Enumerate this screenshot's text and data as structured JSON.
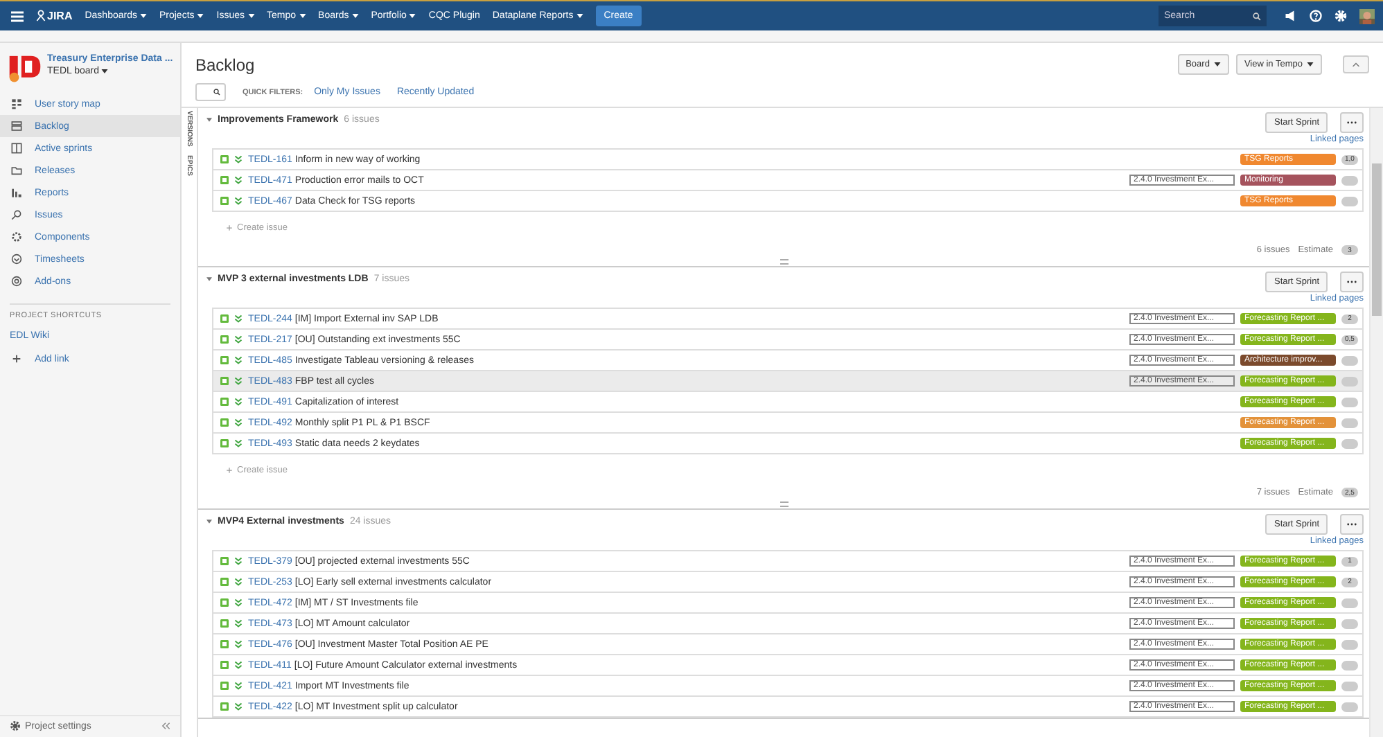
{
  "topnav": {
    "logo": "JIRA",
    "menus": [
      {
        "label": "Dashboards",
        "dropdown": true
      },
      {
        "label": "Projects",
        "dropdown": true
      },
      {
        "label": "Issues",
        "dropdown": true
      },
      {
        "label": "Tempo",
        "dropdown": true
      },
      {
        "label": "Boards",
        "dropdown": true
      },
      {
        "label": "Portfolio",
        "dropdown": true
      },
      {
        "label": "CQC Plugin",
        "dropdown": false
      },
      {
        "label": "Dataplane Reports",
        "dropdown": true
      }
    ],
    "create": "Create",
    "search": {
      "placeholder": "Search"
    }
  },
  "sidebar": {
    "project": "Treasury Enterprise Data ...",
    "board": "TEDL board",
    "items": [
      {
        "label": "User story map",
        "selected": false
      },
      {
        "label": "Backlog",
        "selected": true
      },
      {
        "label": "Active sprints",
        "selected": false
      },
      {
        "label": "Releases",
        "selected": false
      },
      {
        "label": "Reports",
        "selected": false
      },
      {
        "label": "Issues",
        "selected": false
      },
      {
        "label": "Components",
        "selected": false
      },
      {
        "label": "Timesheets",
        "selected": false
      },
      {
        "label": "Add-ons",
        "selected": false
      }
    ],
    "shortcuts_title": "PROJECT SHORTCUTS",
    "shortcuts": [
      "EDL Wiki"
    ],
    "add_link": "Add link",
    "settings": "Project settings"
  },
  "page": {
    "title": "Backlog",
    "quick_filters_label": "QUICK FILTERS:",
    "quick_filters": [
      "Only My Issues",
      "Recently Updated"
    ],
    "buttons": [
      "Board",
      "View in Tempo"
    ],
    "side_tabs": [
      "VERSIONS",
      "EPICS"
    ]
  },
  "sprints": [
    {
      "name": "Improvements Framework",
      "count": "6 issues",
      "start": "Start Sprint",
      "linked": "Linked pages",
      "create": "Create issue",
      "footer_count": "6 issues",
      "estimate_label": "Estimate",
      "estimate": "3",
      "issues": [
        {
          "key": "TEDL-161",
          "summary": "Inform in new way of working",
          "epic": "TSG Reports",
          "color": "#f0882f",
          "estimate": "1,0",
          "highlighted": false
        },
        {
          "key": "TEDL-471",
          "summary": "Production error mails to OCT",
          "version": "2.4.0 Investment Ex...",
          "epic": "Monitoring",
          "color": "#a5535d",
          "highlighted": false
        },
        {
          "key": "TEDL-467",
          "summary": "Data Check for TSG reports",
          "epic": "TSG Reports",
          "color": "#f0882f",
          "highlighted": false
        }
      ]
    },
    {
      "name": "MVP 3 external investments LDB",
      "count": "7 issues",
      "start": "Start Sprint",
      "linked": "Linked pages",
      "create": "Create issue",
      "footer_count": "7 issues",
      "estimate_label": "Estimate",
      "estimate": "2,5",
      "issues": [
        {
          "key": "TEDL-244",
          "summary": "[IM] Import External inv SAP LDB",
          "version": "2.4.0 Investment Ex...",
          "epic": "Forecasting Report ...",
          "color": "#84b51c",
          "estimate": "2",
          "highlighted": false
        },
        {
          "key": "TEDL-217",
          "summary": "[OU] Outstanding ext investments 55C",
          "version": "2.4.0 Investment Ex...",
          "epic": "Forecasting Report ...",
          "color": "#84b51c",
          "estimate": "0,5",
          "highlighted": false
        },
        {
          "key": "TEDL-485",
          "summary": "Investigate Tableau versioning & releases",
          "version": "2.4.0 Investment Ex...",
          "epic": "Architecture improv...",
          "color": "#7b4a2c",
          "highlighted": false
        },
        {
          "key": "TEDL-483",
          "summary": "FBP test all cycles",
          "version": "2.4.0 Investment Ex...",
          "epic": "Forecasting Report ...",
          "color": "#84b51c",
          "highlighted": true
        },
        {
          "key": "TEDL-491",
          "summary": "Capitalization of interest",
          "epic": "Forecasting Report ...",
          "color": "#84b51c",
          "highlighted": false
        },
        {
          "key": "TEDL-492",
          "summary": "Monthly split P1 PL & P1 BSCF",
          "epic": "Forecasting Report ...",
          "color": "#e3923a",
          "highlighted": false
        },
        {
          "key": "TEDL-493",
          "summary": "Static data needs 2 keydates",
          "epic": "Forecasting Report ...",
          "color": "#84b51c",
          "highlighted": false
        }
      ]
    },
    {
      "name": "MVP4 External investments",
      "count": "24 issues",
      "start": "Start Sprint",
      "linked": "Linked pages",
      "issues": [
        {
          "key": "TEDL-379",
          "summary": "[OU] projected external investments 55C",
          "version": "2.4.0 Investment Ex...",
          "epic": "Forecasting Report ...",
          "color": "#84b51c",
          "estimate": "1",
          "highlighted": false
        },
        {
          "key": "TEDL-253",
          "summary": "[LO] Early sell external investments calculator",
          "version": "2.4.0 Investment Ex...",
          "epic": "Forecasting Report ...",
          "color": "#84b51c",
          "estimate": "2",
          "highlighted": false
        },
        {
          "key": "TEDL-472",
          "summary": "[IM] MT / ST Investments file",
          "version": "2.4.0 Investment Ex...",
          "epic": "Forecasting Report ...",
          "color": "#84b51c",
          "highlighted": false
        },
        {
          "key": "TEDL-473",
          "summary": "[LO] MT Amount calculator",
          "version": "2.4.0 Investment Ex...",
          "epic": "Forecasting Report ...",
          "color": "#84b51c",
          "highlighted": false
        },
        {
          "key": "TEDL-476",
          "summary": "[OU] Investment Master Total Position AE PE",
          "version": "2.4.0 Investment Ex...",
          "epic": "Forecasting Report ...",
          "color": "#84b51c",
          "highlighted": false
        },
        {
          "key": "TEDL-411",
          "summary": "[LO] Future Amount Calculator external investments",
          "version": "2.4.0 Investment Ex...",
          "epic": "Forecasting Report ...",
          "color": "#84b51c",
          "highlighted": false
        },
        {
          "key": "TEDL-421",
          "summary": "Import MT Investments file",
          "version": "2.4.0 Investment Ex...",
          "epic": "Forecasting Report ...",
          "color": "#84b51c",
          "highlighted": false
        },
        {
          "key": "TEDL-422",
          "summary": "[LO] MT Investment split up calculator",
          "version": "2.4.0 Investment Ex...",
          "epic": "Forecasting Report ...",
          "color": "#84b51c",
          "highlighted": false
        }
      ]
    }
  ]
}
